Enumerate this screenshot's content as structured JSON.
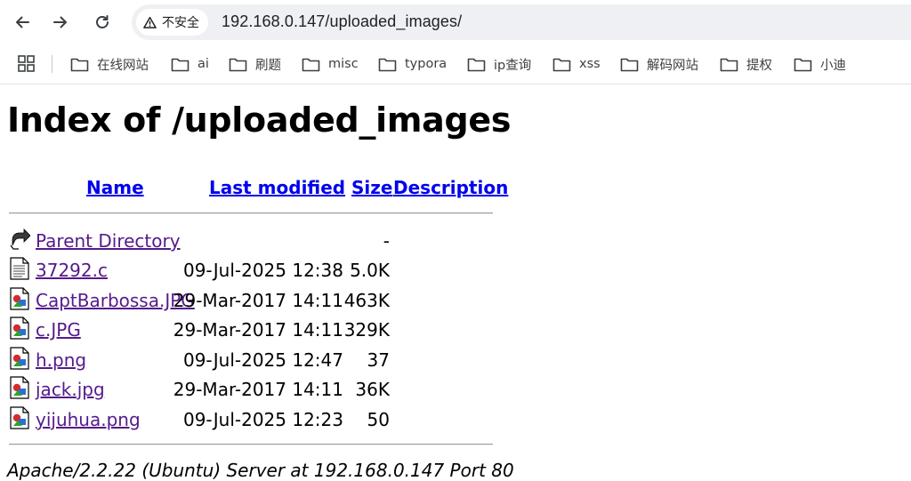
{
  "browser": {
    "security_label": "不安全",
    "url": "192.168.0.147/uploaded_images/",
    "bookmarks": [
      {
        "label": "在线网站"
      },
      {
        "label": "ai"
      },
      {
        "label": "刷题"
      },
      {
        "label": "misc"
      },
      {
        "label": "typora"
      },
      {
        "label": "ip查询"
      },
      {
        "label": "xss"
      },
      {
        "label": "解码网站"
      },
      {
        "label": "提权"
      },
      {
        "label": "小迪"
      }
    ]
  },
  "page": {
    "title": "Index of /uploaded_images",
    "columns": {
      "name": "Name",
      "last_modified": "Last modified",
      "size": "Size",
      "description": "Description"
    },
    "rows": [
      {
        "icon": "back-icon",
        "name": "Parent Directory",
        "modified": "",
        "size": "-"
      },
      {
        "icon": "text-file-icon",
        "name": "37292.c",
        "modified": "09-Jul-2025 12:38",
        "size": "5.0K"
      },
      {
        "icon": "image-file-icon",
        "name": "CaptBarbossa.JPG",
        "modified": "29-Mar-2017 14:11",
        "size": "463K"
      },
      {
        "icon": "image-file-icon",
        "name": "c.JPG",
        "modified": "29-Mar-2017 14:11",
        "size": "329K"
      },
      {
        "icon": "image-file-icon",
        "name": "h.png",
        "modified": "09-Jul-2025 12:47",
        "size": "37"
      },
      {
        "icon": "image-file-icon",
        "name": "jack.jpg",
        "modified": "29-Mar-2017 14:11",
        "size": "36K"
      },
      {
        "icon": "image-file-icon",
        "name": "yijuhua.png",
        "modified": "09-Jul-2025 12:23",
        "size": "50"
      }
    ],
    "server_signature": "Apache/2.2.22 (Ubuntu) Server at 192.168.0.147 Port 80"
  }
}
